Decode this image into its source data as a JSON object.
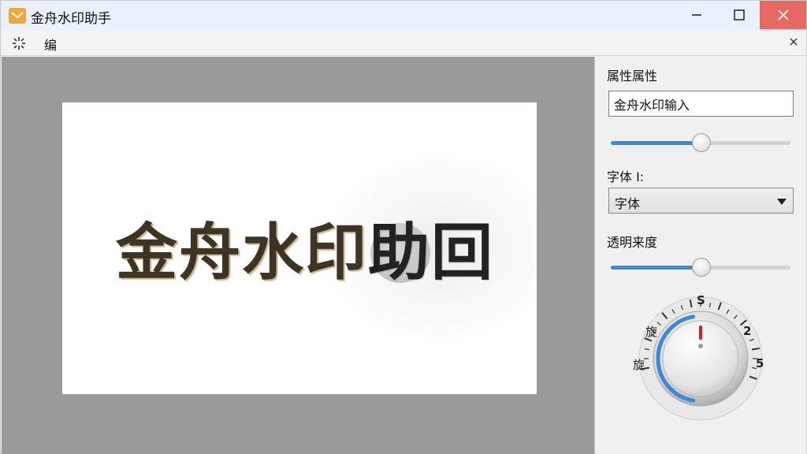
{
  "window": {
    "title": "金舟水印助手",
    "app_icon": "envelope-icon",
    "controls": [
      "minimize-icon",
      "maximize-icon",
      "close-icon"
    ],
    "close_color": "#e46a63"
  },
  "menu": {
    "icon": "sparkle-icon",
    "edit_label": "编",
    "close_icon": "close-icon"
  },
  "canvas": {
    "watermark_part1": "金舟水印",
    "watermark_part2": "助回",
    "background_color": "#9a9a9a"
  },
  "panel": {
    "properties_label": "属性属性",
    "watermark_input_value": "金舟水印输入",
    "size_slider_value": 50,
    "font_label": "字体 ꓲ:",
    "font_select_value": "字体",
    "opacity_label": "透明来度",
    "opacity_slider_value": 50,
    "rotation_knob": {
      "top_label": "S",
      "right_top_label": "2",
      "right_label": "5",
      "left_top_label": "旋",
      "left_label": "旋",
      "indicator_color": "#d11f1f",
      "accent_color": "#3b8ad9"
    }
  }
}
